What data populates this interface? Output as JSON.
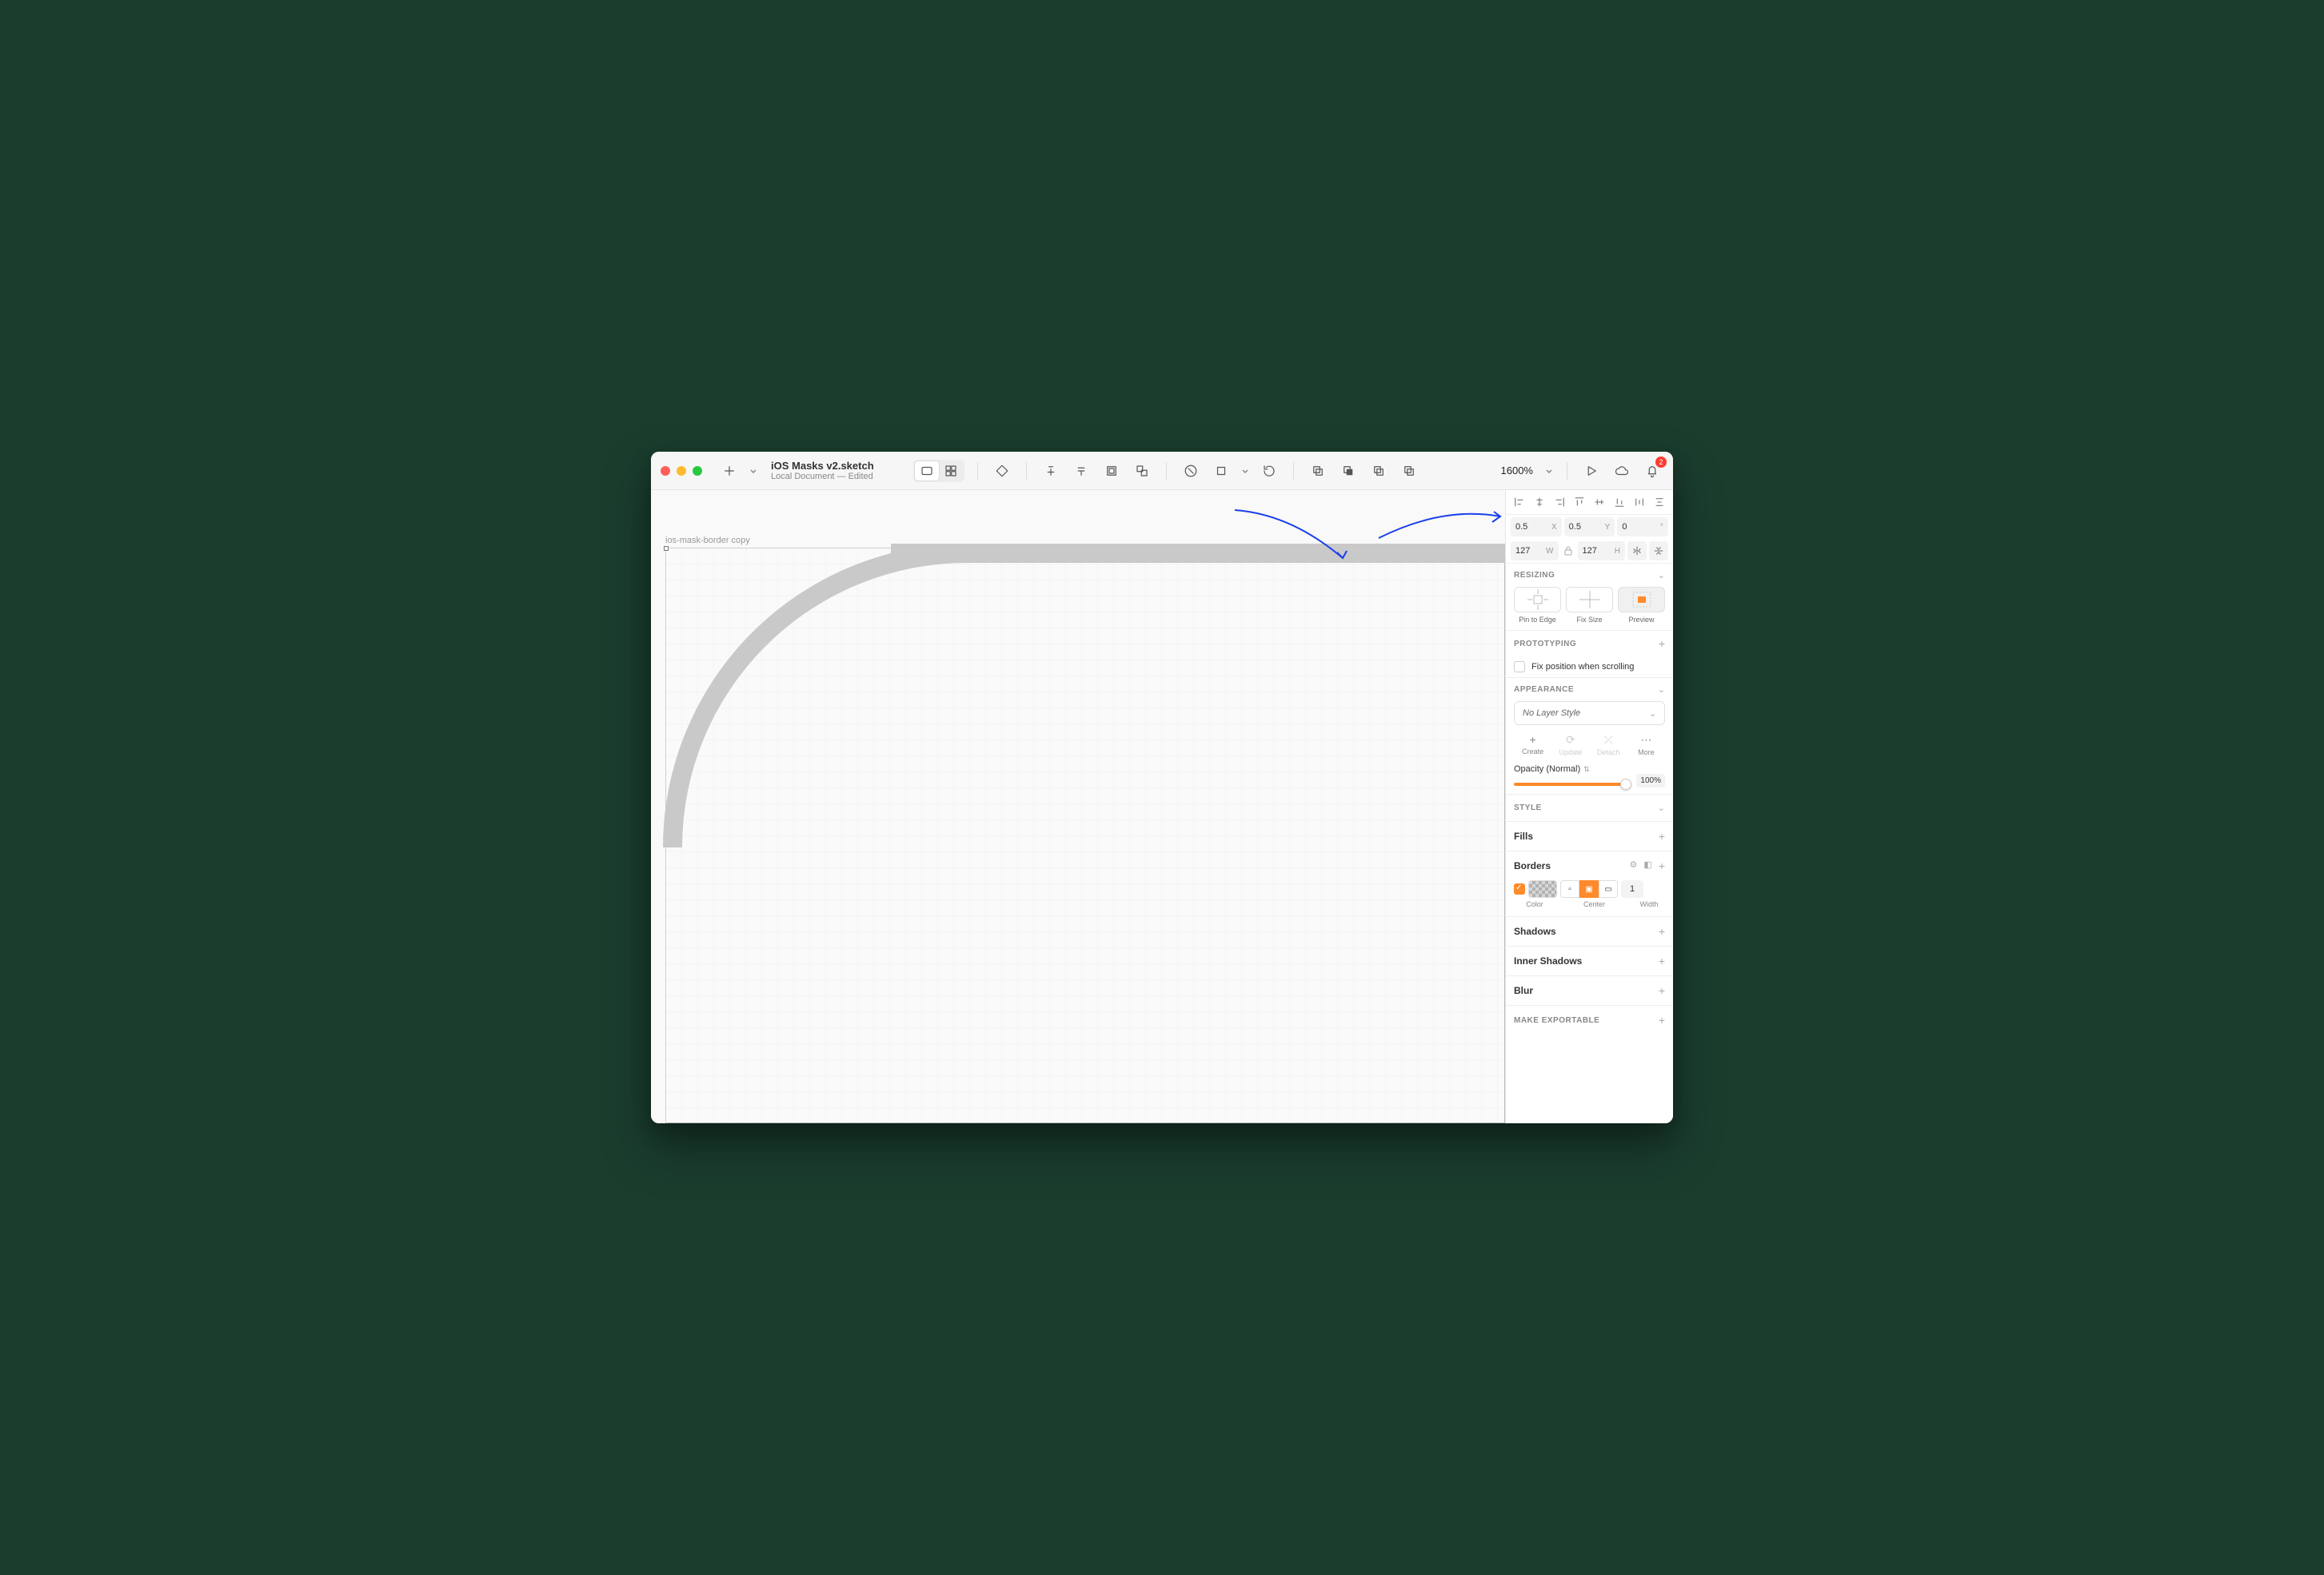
{
  "doc": {
    "title": "iOS Masks v2.sketch",
    "subtitle": "Local Document — Edited"
  },
  "zoom": "1600%",
  "notif_count": "2",
  "layer_name": "ios-mask-border copy",
  "position": {
    "x": "0.5",
    "y": "0.5",
    "rotation": "0",
    "w": "127",
    "h": "127"
  },
  "resizing": {
    "header": "Resizing",
    "opts": [
      "Pin to Edge",
      "Fix Size",
      "Preview"
    ]
  },
  "prototyping": {
    "header": "Prototyping",
    "fix_label": "Fix position when scrolling"
  },
  "appearance": {
    "header": "Appearance",
    "style_label": "No Layer Style",
    "actions": [
      "Create",
      "Update",
      "Detach",
      "More"
    ],
    "opacity_label": "Opacity (Normal)",
    "opacity_value": "100%"
  },
  "style": {
    "header": "Style",
    "fills": "Fills",
    "borders": "Borders",
    "border_width": "1",
    "border_labels": [
      "Color",
      "Center",
      "Width"
    ],
    "shadows": "Shadows",
    "inner_shadows": "Inner Shadows",
    "blur": "Blur"
  },
  "exportable": "Make Exportable"
}
